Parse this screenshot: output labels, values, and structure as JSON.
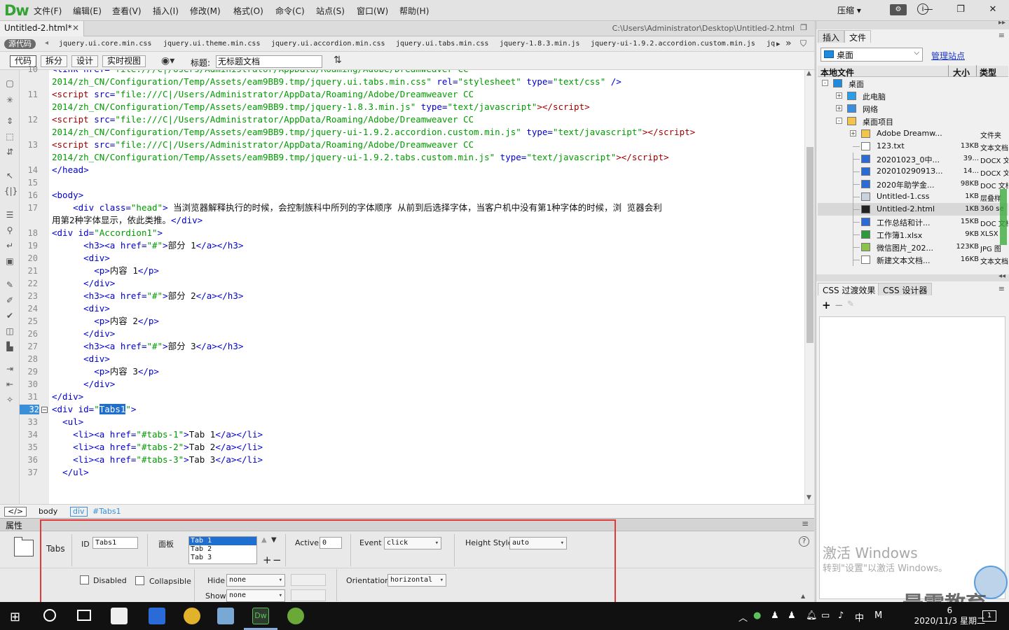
{
  "app": {
    "logo": "Dw",
    "compress_label": "压缩"
  },
  "menu": [
    "文件(F)",
    "编辑(E)",
    "查看(V)",
    "插入(I)",
    "修改(M)",
    "格式(O)",
    "命令(C)",
    "站点(S)",
    "窗口(W)",
    "帮助(H)"
  ],
  "document": {
    "tab_label": "Untitled-2.html*",
    "path": "C:\\Users\\Administrator\\Desktop\\Untitled-2.html",
    "source_badge": "源代码",
    "related_files": [
      "jquery.ui.core.min.css",
      "jquery.ui.theme.min.css",
      "jquery.ui.accordion.min.css",
      "jquery.ui.tabs.min.css",
      "jquery-1.8.3.min.js",
      "jquery-ui-1.9.2.accordion.custom.min.js",
      "jq"
    ],
    "view_buttons": [
      "代码",
      "拆分",
      "设计",
      "实时视图"
    ],
    "title_label": "标题:",
    "title_value": "无标题文档"
  },
  "code": {
    "current_line": "32",
    "lines": [
      {
        "n": "10",
        "html": "<span class=\"tg\">&lt;link href=</span><span class=\"av\">\"file:///C|/Users/Administrator/AppData/Roaming/Adobe/Dreamweaver CC</span>"
      },
      {
        "n": "",
        "html": "<span class=\"av\">2014/zh_CN/Configuration/Temp/Assets/eam9BB9.tmp/jquery.ui.tabs.min.css\"</span><span class=\"tg\"> rel=</span><span class=\"av\">\"stylesheet\"</span><span class=\"tg\"> type=</span><span class=\"av\">\"text/css\"</span><span class=\"tg\"> /&gt;</span>"
      },
      {
        "n": "11",
        "html": "<span style=\"color:#a00000\">&lt;script</span><span class=\"tg\"> src=</span><span class=\"av\">\"file:///C|/Users/Administrator/AppData/Roaming/Adobe/Dreamweaver CC</span>"
      },
      {
        "n": "",
        "html": "<span class=\"av\">2014/zh_CN/Configuration/Temp/Assets/eam9BB9.tmp/jquery-1.8.3.min.js\"</span><span class=\"tg\"> type=</span><span class=\"av\">\"text/javascript\"</span><span style=\"color:#a00000\">&gt;&lt;/script&gt;</span>"
      },
      {
        "n": "12",
        "html": "<span style=\"color:#a00000\">&lt;script</span><span class=\"tg\"> src=</span><span class=\"av\">\"file:///C|/Users/Administrator/AppData/Roaming/Adobe/Dreamweaver CC</span>"
      },
      {
        "n": "",
        "html": "<span class=\"av\">2014/zh_CN/Configuration/Temp/Assets/eam9BB9.tmp/jquery-ui-1.9.2.accordion.custom.min.js\"</span><span class=\"tg\"> type=</span><span class=\"av\">\"text/javascript\"</span><span style=\"color:#a00000\">&gt;&lt;/script&gt;</span>"
      },
      {
        "n": "13",
        "html": "<span style=\"color:#a00000\">&lt;script</span><span class=\"tg\"> src=</span><span class=\"av\">\"file:///C|/Users/Administrator/AppData/Roaming/Adobe/Dreamweaver CC</span>"
      },
      {
        "n": "",
        "html": "<span class=\"av\">2014/zh_CN/Configuration/Temp/Assets/eam9BB9.tmp/jquery-ui-1.9.2.tabs.custom.min.js\"</span><span class=\"tg\"> type=</span><span class=\"av\">\"text/javascript\"</span><span style=\"color:#a00000\">&gt;&lt;/script&gt;</span>"
      },
      {
        "n": "14",
        "html": "<span class=\"tg\">&lt;/head&gt;</span>"
      },
      {
        "n": "15",
        "html": ""
      },
      {
        "n": "16",
        "html": "<span class=\"tg\">&lt;body&gt;</span>"
      },
      {
        "n": "17",
        "html": "    <span class=\"tg\">&lt;div class=</span><span class=\"av\">\"head\"</span><span class=\"tg\">&gt;</span><span class=\"tx\"> 当浏览器解释执行的时候，会控制族科中所列的字体顺序 从前到后选择字体，当客户机中没有第1种字体的时候，浏 览器会利</span>"
      },
      {
        "n": "",
        "html": "<span class=\"tx\">用第2种字体显示，依此类推。</span><span class=\"tg\">&lt;/div&gt;</span>"
      },
      {
        "n": "18",
        "html": "<span class=\"tg\">&lt;div id=</span><span class=\"av\">\"Accordion1\"</span><span class=\"tg\">&gt;</span>"
      },
      {
        "n": "19",
        "html": "      <span class=\"tg\">&lt;h3&gt;&lt;a href=</span><span class=\"av\">\"#\"</span><span class=\"tg\">&gt;</span><span class=\"tx\">部分 1</span><span class=\"tg\">&lt;/a&gt;&lt;/h3&gt;</span>"
      },
      {
        "n": "20",
        "html": "      <span class=\"tg\">&lt;div&gt;</span>"
      },
      {
        "n": "21",
        "html": "        <span class=\"tg\">&lt;p&gt;</span><span class=\"tx\">内容 1</span><span class=\"tg\">&lt;/p&gt;</span>"
      },
      {
        "n": "22",
        "html": "      <span class=\"tg\">&lt;/div&gt;</span>"
      },
      {
        "n": "23",
        "html": "      <span class=\"tg\">&lt;h3&gt;&lt;a href=</span><span class=\"av\">\"#\"</span><span class=\"tg\">&gt;</span><span class=\"tx\">部分 2</span><span class=\"tg\">&lt;/a&gt;&lt;/h3&gt;</span>"
      },
      {
        "n": "24",
        "html": "      <span class=\"tg\">&lt;div&gt;</span>"
      },
      {
        "n": "25",
        "html": "        <span class=\"tg\">&lt;p&gt;</span><span class=\"tx\">内容 2</span><span class=\"tg\">&lt;/p&gt;</span>"
      },
      {
        "n": "26",
        "html": "      <span class=\"tg\">&lt;/div&gt;</span>"
      },
      {
        "n": "27",
        "html": "      <span class=\"tg\">&lt;h3&gt;&lt;a href=</span><span class=\"av\">\"#\"</span><span class=\"tg\">&gt;</span><span class=\"tx\">部分 3</span><span class=\"tg\">&lt;/a&gt;&lt;/h3&gt;</span>"
      },
      {
        "n": "28",
        "html": "      <span class=\"tg\">&lt;div&gt;</span>"
      },
      {
        "n": "29",
        "html": "        <span class=\"tg\">&lt;p&gt;</span><span class=\"tx\">内容 3</span><span class=\"tg\">&lt;/p&gt;</span>"
      },
      {
        "n": "30",
        "html": "      <span class=\"tg\">&lt;/div&gt;</span>"
      },
      {
        "n": "31",
        "html": "<span class=\"tg\">&lt;/div&gt;</span>"
      },
      {
        "n": "32",
        "html": "<span class=\"tg\">&lt;div id=</span><span class=\"av\">\"</span><span class=\"sel\">Tabs1</span><span class=\"av\">\"</span><span class=\"tg\">&gt;</span>"
      },
      {
        "n": "33",
        "html": "  <span class=\"tg\">&lt;ul&gt;</span>"
      },
      {
        "n": "34",
        "html": "    <span class=\"tg\">&lt;li&gt;&lt;a href=</span><span class=\"av\">\"#tabs-1\"</span><span class=\"tg\">&gt;</span><span class=\"tx\">Tab 1</span><span class=\"tg\">&lt;/a&gt;&lt;/li&gt;</span>"
      },
      {
        "n": "35",
        "html": "    <span class=\"tg\">&lt;li&gt;&lt;a href=</span><span class=\"av\">\"#tabs-2\"</span><span class=\"tg\">&gt;</span><span class=\"tx\">Tab 2</span><span class=\"tg\">&lt;/a&gt;&lt;/li&gt;</span>"
      },
      {
        "n": "36",
        "html": "    <span class=\"tg\">&lt;li&gt;&lt;a href=</span><span class=\"av\">\"#tabs-3\"</span><span class=\"tg\">&gt;</span><span class=\"tx\">Tab 3</span><span class=\"tg\">&lt;/a&gt;&lt;/li&gt;</span>"
      },
      {
        "n": "37",
        "html": "  <span class=\"tg\">&lt;/ul&gt;</span>"
      }
    ]
  },
  "status": {
    "code_tag": "</>",
    "crumbs": [
      "body",
      "div",
      "#Tabs1"
    ]
  },
  "properties": {
    "header": "属性",
    "widget_label": "Tabs",
    "id_label": "ID",
    "id_value": "Tabs1",
    "panels_label": "面板",
    "panels": [
      "Tab 1",
      "Tab 2",
      "Tab 3"
    ],
    "active_label": "Active",
    "active_value": "0",
    "event_label": "Event",
    "event_value": "click",
    "height_label": "Height Style",
    "height_value": "auto",
    "disabled_label": "Disabled",
    "collapsible_label": "Collapsible",
    "hide_label": "Hide",
    "hide_value": "none",
    "show_label": "Show",
    "show_value": "none",
    "orientation_label": "Orientation",
    "orientation_value": "horizontal"
  },
  "right_panel": {
    "tabs": [
      "插入",
      "文件"
    ],
    "site": "桌面",
    "manage_link": "管理站点",
    "file_headers": {
      "name": "本地文件",
      "size": "大小",
      "type": "类型"
    },
    "tree": [
      {
        "name": "桌面",
        "size": "",
        "type": "",
        "level": 0,
        "icon": "desktop",
        "exp": "-"
      },
      {
        "name": "此电脑",
        "size": "",
        "type": "",
        "level": 1,
        "icon": "computer",
        "exp": "+"
      },
      {
        "name": "网络",
        "size": "",
        "type": "",
        "level": 1,
        "icon": "network",
        "exp": "+"
      },
      {
        "name": "桌面项目",
        "size": "",
        "type": "",
        "level": 1,
        "icon": "folder",
        "exp": "-"
      },
      {
        "name": "Adobe Dreamw...",
        "size": "",
        "type": "文件夹",
        "level": 2,
        "icon": "folder",
        "exp": "+"
      },
      {
        "name": "123.txt",
        "size": "13KB",
        "type": "文本文档",
        "level": 2,
        "icon": "txt",
        "exp": ""
      },
      {
        "name": "20201023_0中...",
        "size": "39...",
        "type": "DOCX 文",
        "level": 2,
        "icon": "doc",
        "exp": ""
      },
      {
        "name": "20201029091З...",
        "size": "14...",
        "type": "DOCX 文",
        "level": 2,
        "icon": "doc",
        "exp": ""
      },
      {
        "name": "2020年助学金...",
        "size": "98KB",
        "type": "DOC 文档",
        "level": 2,
        "icon": "doc",
        "exp": ""
      },
      {
        "name": "Untitled-1.css",
        "size": "1KB",
        "type": "层叠样",
        "level": 2,
        "icon": "css",
        "exp": ""
      },
      {
        "name": "Untitled-2.html",
        "size": "1KB",
        "type": "360 se",
        "level": 2,
        "icon": "html",
        "exp": "",
        "selected": true
      },
      {
        "name": "工作总结和计...",
        "size": "15KB",
        "type": "DOC 文档",
        "level": 2,
        "icon": "doc",
        "exp": ""
      },
      {
        "name": "工作簿1.xlsx",
        "size": "9KB",
        "type": "XLSX",
        "level": 2,
        "icon": "xls",
        "exp": ""
      },
      {
        "name": "微信图片_202...",
        "size": "123KB",
        "type": "JPG 图",
        "level": 2,
        "icon": "img",
        "exp": ""
      },
      {
        "name": "新建文本文档...",
        "size": "16KB",
        "type": "文本文档",
        "level": 2,
        "icon": "txt",
        "exp": ""
      }
    ],
    "css_tabs": [
      "CSS 过渡效果",
      "CSS 设计器"
    ]
  },
  "overlay": {
    "activate_title": "激活 Windows",
    "activate_sub": "转到\"设置\"以激活 Windows。",
    "watermark": "最需教育"
  },
  "taskbar": {
    "time": "6",
    "date": "2020/11/3 星期二",
    "ime": "中",
    "ime2": "M",
    "notif_count": "1"
  }
}
